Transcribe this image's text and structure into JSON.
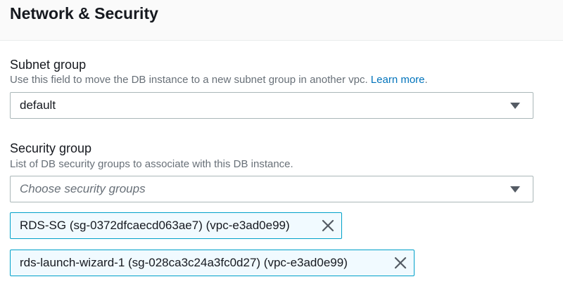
{
  "section": {
    "title": "Network & Security"
  },
  "subnet_group": {
    "label": "Subnet group",
    "description": "Use this field to move the DB instance to a new subnet group in another vpc.",
    "learn_more": "Learn more",
    "period": ".",
    "selected_value": "default",
    "caret_icon": "caret-down-icon"
  },
  "security_group": {
    "label": "Security group",
    "description": "List of DB security groups to associate with this DB instance.",
    "placeholder": "Choose security groups",
    "caret_icon": "caret-down-icon",
    "tokens": [
      {
        "label": "RDS-SG (sg-0372dfcaecd063ae7) (vpc-e3ad0e99)",
        "remove_icon": "close-icon"
      },
      {
        "label": "rds-launch-wizard-1 (sg-028ca3c24a3fc0d27) (vpc-e3ad0e99)",
        "remove_icon": "close-icon"
      }
    ]
  },
  "colors": {
    "link": "#0073bb",
    "token_border": "#00a1c9",
    "token_bg": "#f1faff"
  }
}
